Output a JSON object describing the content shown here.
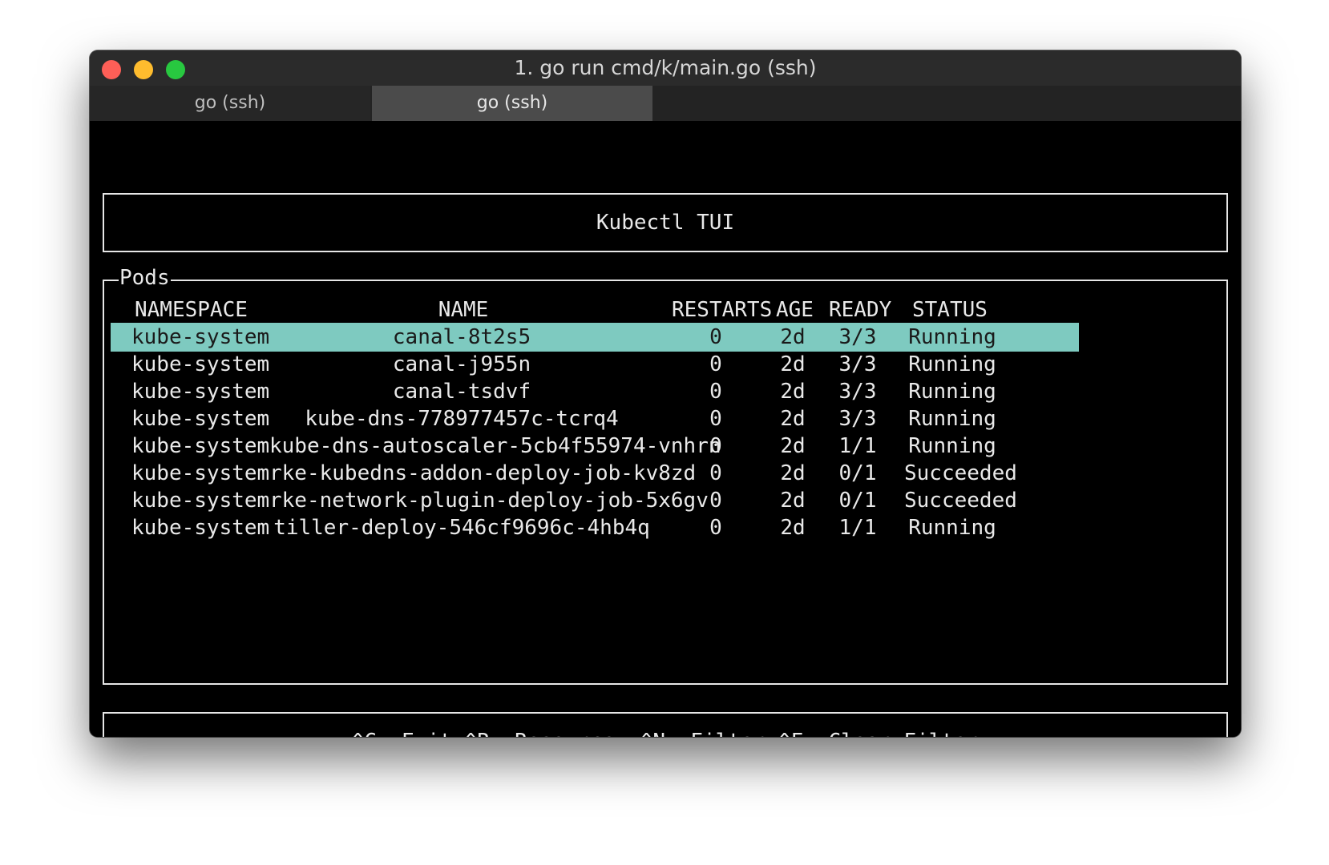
{
  "window": {
    "title": "1. go run cmd/k/main.go (ssh)"
  },
  "tabs": [
    {
      "label": "go (ssh)",
      "active": false
    },
    {
      "label": "go (ssh)",
      "active": true
    }
  ],
  "app": {
    "header": "Kubectl TUI",
    "pods_panel_label": "Pods",
    "footer": "^C: Exit ^R: Resource, ^N: Filter ^F: Clear Filter",
    "selection_color": "#7ecac0"
  },
  "table": {
    "columns": [
      "NAMESPACE",
      "NAME",
      "RESTARTS",
      "AGE",
      "READY",
      "STATUS"
    ],
    "selected_index": 0,
    "rows": [
      {
        "namespace": "kube-system",
        "name": "canal-8t2s5",
        "restarts": "0",
        "age": "2d",
        "ready": "3/3",
        "status": "Running"
      },
      {
        "namespace": "kube-system",
        "name": "canal-j955n",
        "restarts": "0",
        "age": "2d",
        "ready": "3/3",
        "status": "Running"
      },
      {
        "namespace": "kube-system",
        "name": "canal-tsdvf",
        "restarts": "0",
        "age": "2d",
        "ready": "3/3",
        "status": "Running"
      },
      {
        "namespace": "kube-system",
        "name": "kube-dns-778977457c-tcrq4",
        "restarts": "0",
        "age": "2d",
        "ready": "3/3",
        "status": "Running"
      },
      {
        "namespace": "kube-system",
        "name": "kube-dns-autoscaler-5cb4f55974-vnhrn",
        "restarts": "0",
        "age": "2d",
        "ready": "1/1",
        "status": "Running"
      },
      {
        "namespace": "kube-system",
        "name": "rke-kubedns-addon-deploy-job-kv8zd",
        "restarts": "0",
        "age": "2d",
        "ready": "0/1",
        "status": "Succeeded"
      },
      {
        "namespace": "kube-system",
        "name": "rke-network-plugin-deploy-job-5x6gv",
        "restarts": "0",
        "age": "2d",
        "ready": "0/1",
        "status": "Succeeded"
      },
      {
        "namespace": "kube-system",
        "name": "tiller-deploy-546cf9696c-4hb4q",
        "restarts": "0",
        "age": "2d",
        "ready": "1/1",
        "status": "Running"
      }
    ]
  }
}
